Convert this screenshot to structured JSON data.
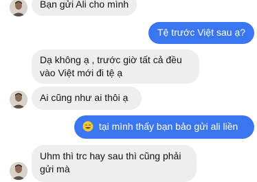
{
  "accent_color": "#3a76ef",
  "incoming_bubble_color": "#eeeeee",
  "messages": [
    {
      "sender": "contact",
      "text": "Bạn gửi Ali cho mình"
    },
    {
      "sender": "me",
      "text": "Tệ trước Việt sau ạ?"
    },
    {
      "sender": "contact",
      "line1": "Dạ không ạ , trước giờ tất cả đều",
      "line2": "vào Việt mới đi tệ ạ"
    },
    {
      "sender": "contact",
      "text": "Ai cũng như ai thôi ạ"
    },
    {
      "sender": "me",
      "emoji": "grinning-sweat-emoji",
      "text": "tại mình thấy bạn bảo gửi ali liền"
    },
    {
      "sender": "contact",
      "line1": "Uhm thì trc hay sau thì cũng phải",
      "line2": "gửi mà"
    }
  ]
}
